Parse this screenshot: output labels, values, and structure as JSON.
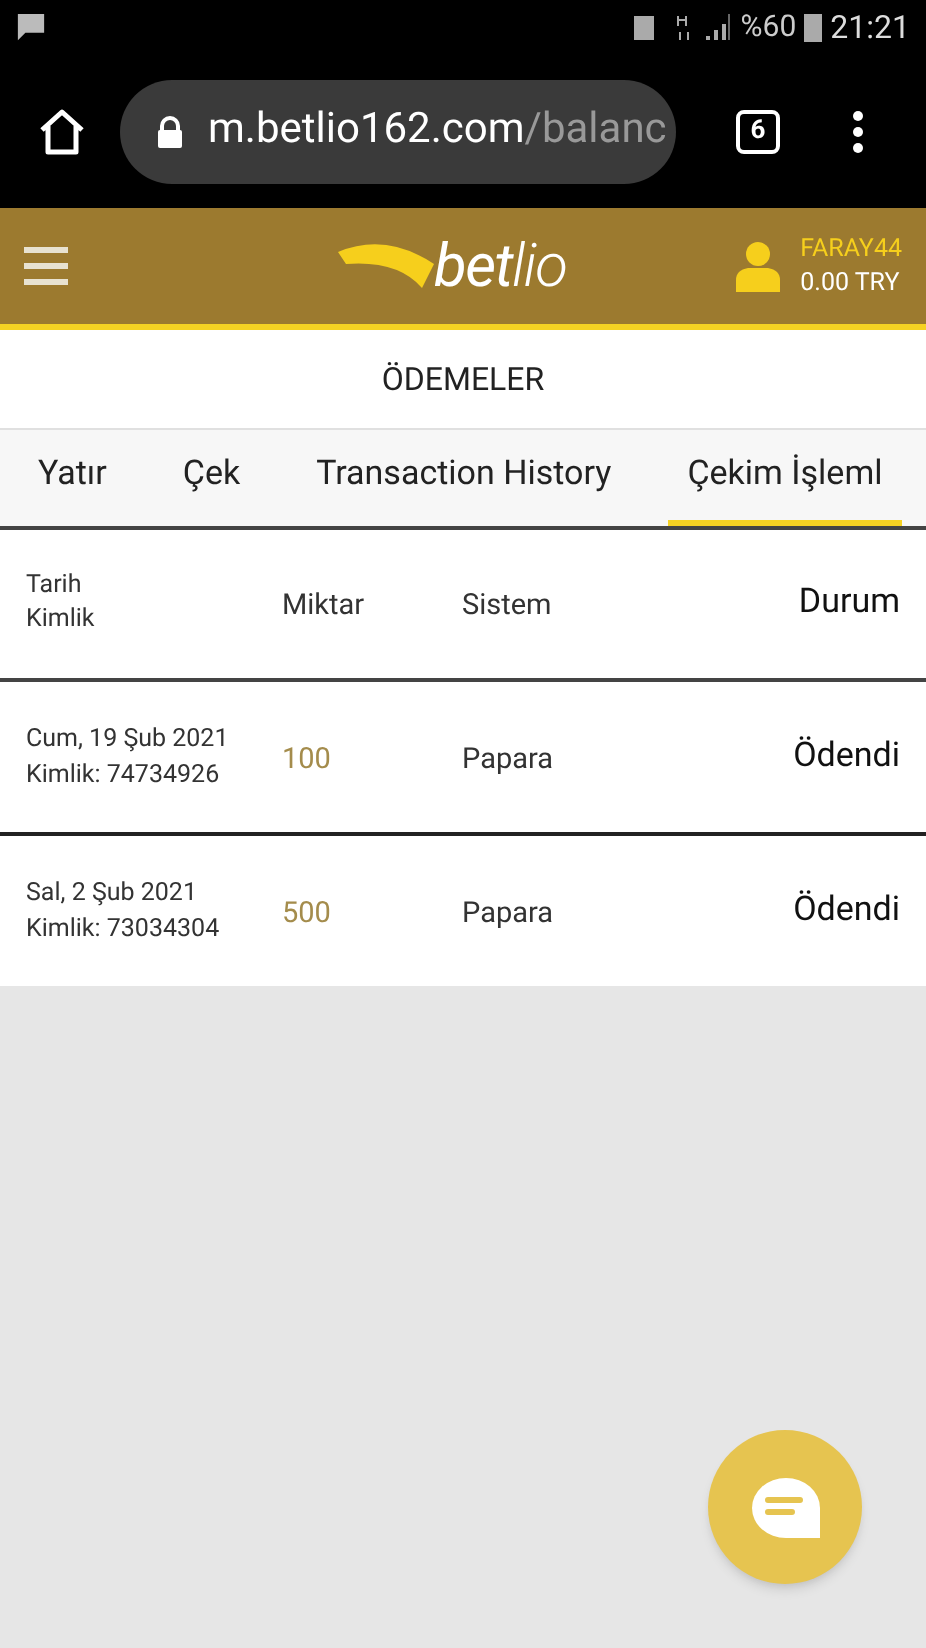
{
  "status_bar": {
    "battery": "%60",
    "time": "21:21"
  },
  "browser": {
    "url_host": "m.betlio162.com",
    "url_path": "/balanc",
    "tab_count": "6"
  },
  "header": {
    "logo": "**bet**lio",
    "username": "FARAY44",
    "balance": "0.00 TRY"
  },
  "page_title": "ÖDEMELER",
  "tabs": [
    {
      "label": "Yatır",
      "selected": false
    },
    {
      "label": "Çek",
      "selected": false
    },
    {
      "label": "Transaction History",
      "selected": false
    },
    {
      "label": "Çekim İşleml",
      "selected": true
    }
  ],
  "table": {
    "columns": [
      {
        "lines": [
          "Tarih",
          "Kimlik"
        ]
      },
      {
        "lines": [
          "Miktar"
        ]
      },
      {
        "lines": [
          "Sistem"
        ]
      },
      {
        "lines": [
          "Durum"
        ]
      }
    ],
    "rows": [
      {
        "date": "Cum, 19 Şub 2021",
        "id": "Kimlik: 74734926",
        "amount": "100",
        "system": "Papara",
        "status": "Ödendi"
      },
      {
        "date": "Sal, 2 Şub 2021",
        "id": "Kimlik: 73034304",
        "amount": "500",
        "system": "Papara",
        "status": "Ödendi"
      }
    ]
  }
}
